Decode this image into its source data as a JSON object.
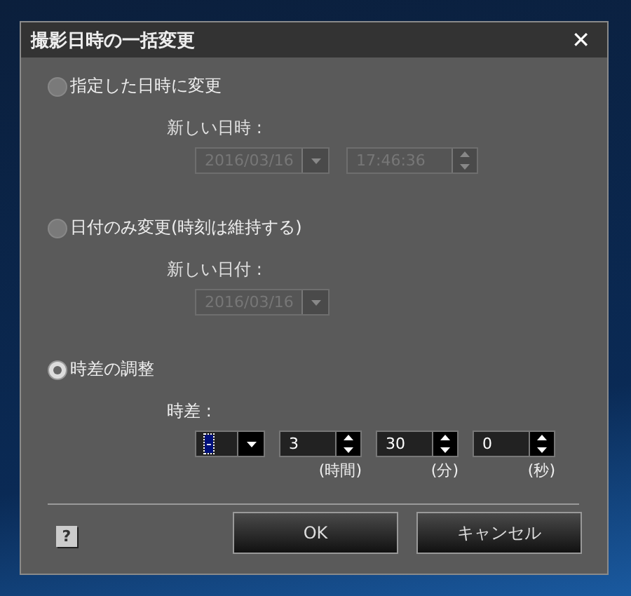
{
  "dialog": {
    "title": "撮影日時の一括変更",
    "close": "✕"
  },
  "options": [
    {
      "kind": "datetime",
      "label": "指定した日時に変更",
      "selected": false,
      "field_label": "新しい日時 :",
      "date": "2016/03/16",
      "time": "17:46:36"
    },
    {
      "kind": "date",
      "label": "日付のみ変更(時刻は維持する)",
      "selected": false,
      "field_label": "新しい日付 :",
      "date": "2016/03/16"
    },
    {
      "kind": "offset",
      "label": "時差の調整",
      "selected": true,
      "field_label": "時差 :",
      "sign": "-",
      "parts": [
        {
          "value": "3",
          "unit": "(時間)"
        },
        {
          "value": "30",
          "unit": "(分)"
        },
        {
          "value": "0",
          "unit": "(秒)"
        }
      ]
    }
  ],
  "help": "?",
  "buttons": [
    "OK",
    "キャンセル"
  ]
}
